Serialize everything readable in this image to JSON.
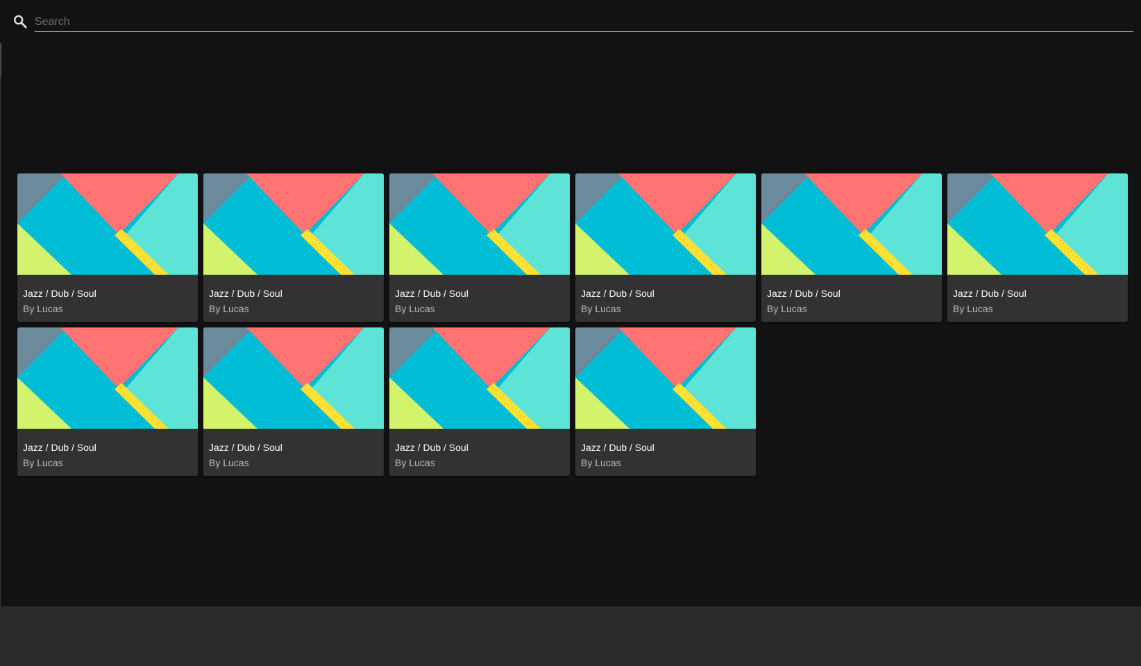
{
  "search": {
    "placeholder": "Search",
    "value": "",
    "icon": "search-icon"
  },
  "colors": {
    "background": "#121212",
    "footer": "#2b2b2b",
    "card": "#323232",
    "art_slate": "#6b8a9c",
    "art_coral": "#ff7373",
    "art_cyan": "#00bcd4",
    "art_teal": "#5ee4d6",
    "art_lime": "#d4f36c",
    "art_yellow": "#ffe033"
  },
  "albums": [
    {
      "title": "Jazz / Dub / Soul",
      "subtitle": "By Lucas"
    },
    {
      "title": "Jazz / Dub / Soul",
      "subtitle": "By Lucas"
    },
    {
      "title": "Jazz / Dub / Soul",
      "subtitle": "By Lucas"
    },
    {
      "title": "Jazz / Dub / Soul",
      "subtitle": "By Lucas"
    },
    {
      "title": "Jazz / Dub / Soul",
      "subtitle": "By Lucas"
    },
    {
      "title": "Jazz / Dub / Soul",
      "subtitle": "By Lucas"
    },
    {
      "title": "Jazz / Dub / Soul",
      "subtitle": "By Lucas"
    },
    {
      "title": "Jazz / Dub / Soul",
      "subtitle": "By Lucas"
    },
    {
      "title": "Jazz / Dub / Soul",
      "subtitle": "By Lucas"
    },
    {
      "title": "Jazz / Dub / Soul",
      "subtitle": "By Lucas"
    }
  ]
}
